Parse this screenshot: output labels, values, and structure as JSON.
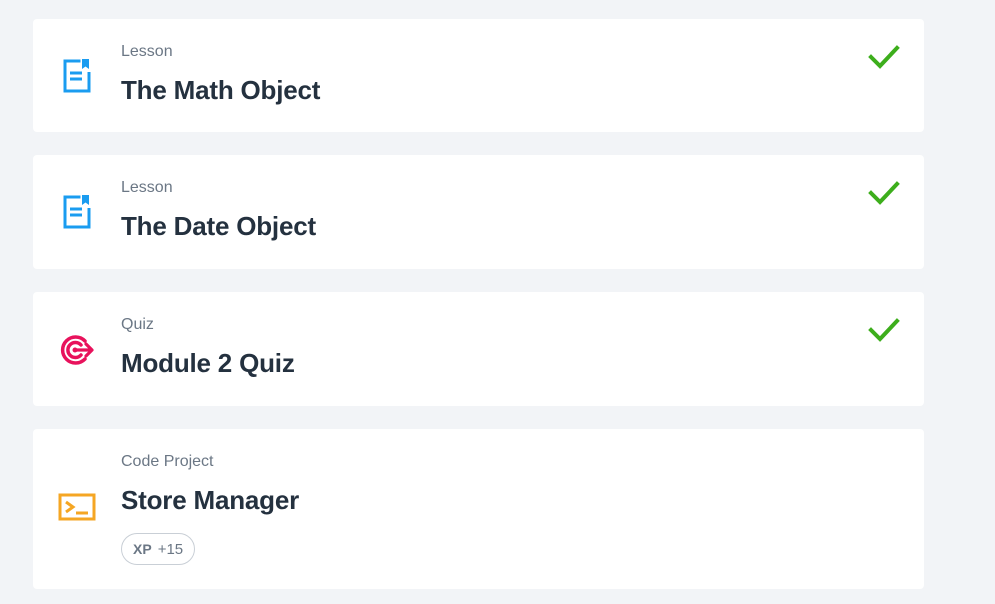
{
  "items": [
    {
      "type_label": "Lesson",
      "title": "The Math Object",
      "icon": "lesson-doc-icon",
      "completed": true
    },
    {
      "type_label": "Lesson",
      "title": "The Date Object",
      "icon": "lesson-doc-icon",
      "completed": true
    },
    {
      "type_label": "Quiz",
      "title": "Module 2 Quiz",
      "icon": "quiz-target-icon",
      "completed": true
    },
    {
      "type_label": "Code Project",
      "title": "Store Manager",
      "icon": "code-terminal-icon",
      "completed": false,
      "xp_label": "XP",
      "xp_value": "+15"
    }
  ],
  "colors": {
    "lesson_icon": "#1a9cf0",
    "quiz_icon": "#e8125c",
    "code_icon": "#f5a623",
    "check": "#3dae1c",
    "background": "#f2f4f7",
    "card": "#ffffff"
  }
}
